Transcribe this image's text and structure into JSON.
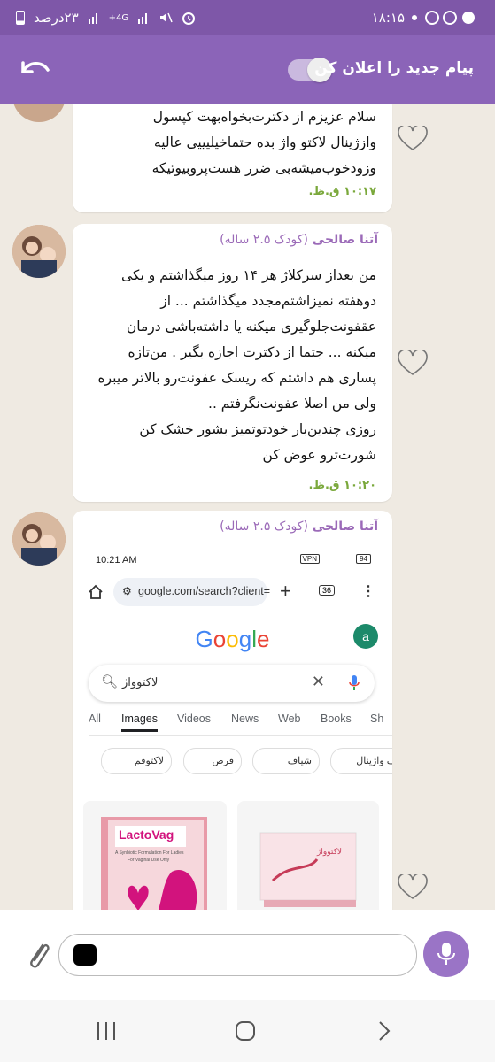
{
  "status_bar": {
    "time": "۱۸:۱۵",
    "battery": "۲۳درصد",
    "network": "4G+"
  },
  "header": {
    "title": "پیام جدید را اعلان کن",
    "toggle_on": true
  },
  "messages": [
    {
      "text": "سلام عزیزم از دکترت‌بخواه‌بهت کپسول\nوازژینال لاکتو واژ بده حتماخیلیییی عالیه\nوزودخوب‌میشه‌بی ضرر هست‌پروبیوتیکه",
      "time": "۱۰:۱۷ ق.ظ."
    },
    {
      "author": "آتنا صالحی",
      "author_sub": "(کودک ۲.۵ ساله)",
      "text": "من بعداز سرکلاژ هر ۱۴ روز میگذاشتم و یکی\nدوهفته نمیزاشتم‌مجدد میگذاشتم ... از\nعقفونت‌جلوگیری میکنه یا داشته‌باشی درمان\nمیکنه ... جتما از دکترت اجازه بگیر . من‌تازه\nپساری هم داشتم که ریسک عفونت‌رو بالاتر میبره\nولی من اصلا عفونت‌نگرفتم ..\nروزی چندین‌بار خودتوتمیز بشور خشک کن\nشورت‌ترو عوض کن",
      "time": "۱۰:۲۰ ق.ظ."
    },
    {
      "author": "آتنا صالحی",
      "author_sub": "(کودک ۲.۵ ساله)",
      "screenshot": {
        "time": "10:21 AM",
        "vpn": "VPN",
        "battery": "94",
        "url": "google.com/search?client=",
        "tab_count": "36",
        "google": "Google",
        "account_initial": "a",
        "query": "لاکتوواژ",
        "tabs": [
          "All",
          "Images",
          "Videos",
          "News",
          "Web",
          "Books",
          "Sh"
        ],
        "active_tab": "Images",
        "chips": [
          "شیاف واژینال",
          "شیاف",
          "قرص",
          "لاکتوفم"
        ],
        "product_brand": "LactoVag",
        "product_tagline": "A Synbiotic Formulation For Ladies",
        "product_tagline2": "For Vaginal Use Only",
        "product2_label": "لاکتوواژ"
      }
    }
  ],
  "composer": {
    "placeholder": ""
  }
}
